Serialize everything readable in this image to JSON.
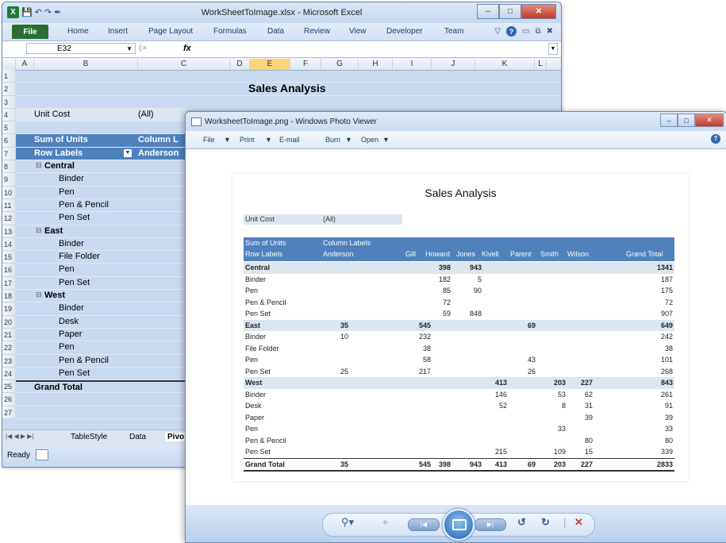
{
  "excel": {
    "title": "WorkSheetToImage.xlsx - Microsoft Excel",
    "qat_icons": [
      "excel-logo-icon",
      "save-icon",
      "undo-icon",
      "redo-icon",
      "brush-icon"
    ],
    "ribbon_tabs": [
      "File",
      "Home",
      "Insert",
      "Page Layout",
      "Formulas",
      "Data",
      "Review",
      "View",
      "Developer",
      "Team"
    ],
    "namebox": "E32",
    "fx_label": "fx",
    "columns": [
      "A",
      "B",
      "C",
      "D",
      "E",
      "F",
      "G",
      "H",
      "I",
      "J",
      "K",
      "L"
    ],
    "rows": [
      "1",
      "2",
      "3",
      "4",
      "5",
      "6",
      "7",
      "8",
      "9",
      "10",
      "11",
      "12",
      "13",
      "14",
      "15",
      "16",
      "17",
      "18",
      "19",
      "20",
      "21",
      "22",
      "23",
      "24",
      "25",
      "26",
      "27"
    ],
    "cells": {
      "sales_analysis": "Sales Analysis",
      "unit_cost": "Unit Cost",
      "unit_cost_val": "(All)",
      "sum_units": "Sum of Units",
      "col_labels": "Column L",
      "row_labels": "Row Labels",
      "anderson": "Anderson",
      "central": "Central",
      "east": "East",
      "west": "West",
      "binder": "Binder",
      "pen": "Pen",
      "pen_pencil": "Pen & Pencil",
      "pen_set": "Pen Set",
      "file_folder": "File Folder",
      "desk": "Desk",
      "paper": "Paper",
      "grand_total": "Grand Total"
    },
    "sheet_tabs": [
      "TableStyle",
      "Data",
      "Pivo"
    ],
    "status": "Ready"
  },
  "viewer": {
    "title": "WorksheetToImage.png - Windows Photo Viewer",
    "menu": [
      "File",
      "Print",
      "E-mail",
      "Burn",
      "Open"
    ],
    "image": {
      "title": "Sales Analysis",
      "unit_cost_label": "Unit Cost",
      "unit_cost_value": "(All)",
      "hdr_sum": "Sum of Units",
      "hdr_col_labels": "Column Labels",
      "hdr_row_labels": "Row Labels",
      "columns": [
        "Anderson",
        "Gill",
        "Howard",
        "Jones",
        "Kivell",
        "Parent",
        "Smith",
        "Wilson",
        "Grand Total"
      ],
      "rows": [
        {
          "label": "Central",
          "group": true,
          "v": [
            "",
            "",
            "398",
            "943",
            "",
            "",
            "",
            "",
            "1341"
          ]
        },
        {
          "label": "Binder",
          "v": [
            "",
            "",
            "182",
            "5",
            "",
            "",
            "",
            "",
            "187"
          ]
        },
        {
          "label": "Pen",
          "v": [
            "",
            "",
            "85",
            "90",
            "",
            "",
            "",
            "",
            "175"
          ]
        },
        {
          "label": "Pen & Pencil",
          "v": [
            "",
            "",
            "72",
            "",
            "",
            "",
            "",
            "",
            "72"
          ]
        },
        {
          "label": "Pen Set",
          "v": [
            "",
            "",
            "59",
            "848",
            "",
            "",
            "",
            "",
            "907"
          ]
        },
        {
          "label": "East",
          "group": true,
          "v": [
            "35",
            "545",
            "",
            "",
            "",
            "69",
            "",
            "",
            "649"
          ]
        },
        {
          "label": "Binder",
          "v": [
            "10",
            "232",
            "",
            "",
            "",
            "",
            "",
            "",
            "242"
          ]
        },
        {
          "label": "File Folder",
          "v": [
            "",
            "38",
            "",
            "",
            "",
            "",
            "",
            "",
            "38"
          ]
        },
        {
          "label": "Pen",
          "v": [
            "",
            "58",
            "",
            "",
            "",
            "43",
            "",
            "",
            "101"
          ]
        },
        {
          "label": "Pen Set",
          "v": [
            "25",
            "217",
            "",
            "",
            "",
            "26",
            "",
            "",
            "268"
          ]
        },
        {
          "label": "West",
          "group": true,
          "v": [
            "",
            "",
            "",
            "",
            "413",
            "",
            "203",
            "227",
            "843"
          ]
        },
        {
          "label": "Binder",
          "v": [
            "",
            "",
            "",
            "",
            "146",
            "",
            "53",
            "62",
            "261"
          ]
        },
        {
          "label": "Desk",
          "v": [
            "",
            "",
            "",
            "",
            "52",
            "",
            "8",
            "31",
            "91"
          ]
        },
        {
          "label": "Paper",
          "v": [
            "",
            "",
            "",
            "",
            "",
            "",
            "",
            "39",
            "39"
          ]
        },
        {
          "label": "Pen",
          "v": [
            "",
            "",
            "",
            "",
            "",
            "",
            "33",
            "",
            "33"
          ]
        },
        {
          "label": "Pen & Pencil",
          "v": [
            "",
            "",
            "",
            "",
            "",
            "",
            "",
            "80",
            "80"
          ]
        },
        {
          "label": "Pen Set",
          "v": [
            "",
            "",
            "",
            "",
            "215",
            "",
            "109",
            "15",
            "339"
          ]
        },
        {
          "label": "Grand Total",
          "total": true,
          "v": [
            "35",
            "545",
            "398",
            "943",
            "413",
            "69",
            "203",
            "227",
            "2833"
          ]
        }
      ]
    },
    "toolbar_icons": [
      "zoom-icon",
      "fit-icon",
      "previous-icon",
      "slideshow-icon",
      "next-icon",
      "rotate-left-icon",
      "rotate-right-icon",
      "delete-icon"
    ]
  }
}
